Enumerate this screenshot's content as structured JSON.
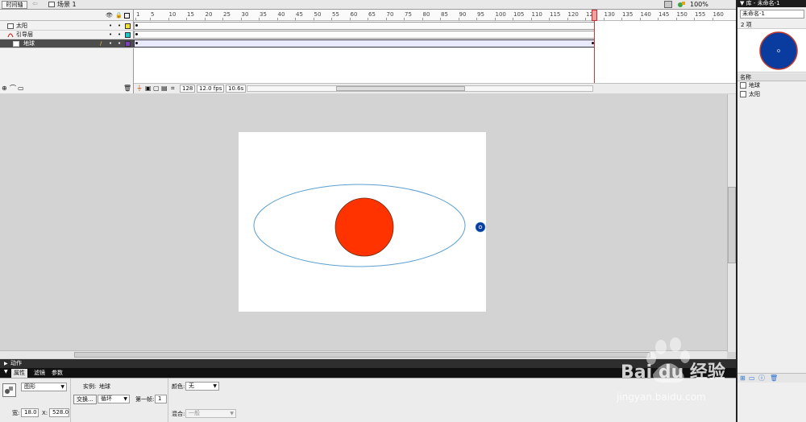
{
  "toolbar": {
    "timeline_button": "时间轴",
    "back_arrow": "⇦",
    "scene": "场景 1",
    "zoom": "100%"
  },
  "timeline": {
    "layers": [
      {
        "name": "太阳",
        "color": "#f5e12f"
      },
      {
        "name": "引导层",
        "color": "#19c9c9"
      },
      {
        "name": "地球",
        "color": "#7f3fbf",
        "selected": true
      }
    ],
    "ruler_ticks": [
      "1",
      "5",
      "10",
      "15",
      "20",
      "25",
      "30",
      "35",
      "40",
      "45",
      "50",
      "55",
      "60",
      "65",
      "70",
      "75",
      "80",
      "85",
      "90",
      "95",
      "100",
      "105",
      "110",
      "115",
      "120",
      "125",
      "130",
      "135",
      "140",
      "145",
      "150",
      "155",
      "160"
    ],
    "current_frame": "128",
    "fps": "12.0 fps",
    "elapsed": "10.6s",
    "layer_header_icons": [
      "eye-icon",
      "lock-icon",
      "outline-icon"
    ],
    "dot": "•"
  },
  "actions_panel": {
    "label": "动作",
    "arrow": "▶"
  },
  "properties": {
    "tabs": [
      "属性",
      "滤镜",
      "参数"
    ],
    "symbol_type": "图形",
    "instance_label": "实例:",
    "instance_name": "地球",
    "swap_button": "交换...",
    "loop_mode": "循环",
    "first_frame_label": "第一帧:",
    "first_frame_value": "1",
    "color_label": "颜色:",
    "color_value": "无",
    "blend_label": "混合:",
    "blend_value": "一般",
    "width_label": "宽:",
    "width_value": "18.0",
    "x_label": "X:",
    "x_value": "528.0"
  },
  "library": {
    "title": "▼ 库 - 未命名-1",
    "document": "未命名-1",
    "count": "2 项",
    "column_name": "名称",
    "items": [
      "地球",
      "太阳"
    ]
  },
  "watermark": {
    "brand": "Bai du 经验",
    "url": "jingyan.baidu.com"
  },
  "colors": {
    "sun": "#ff3300",
    "earth": "#0a3ca0",
    "orbit": "#5a9fd0",
    "playhead": "#e53030"
  }
}
